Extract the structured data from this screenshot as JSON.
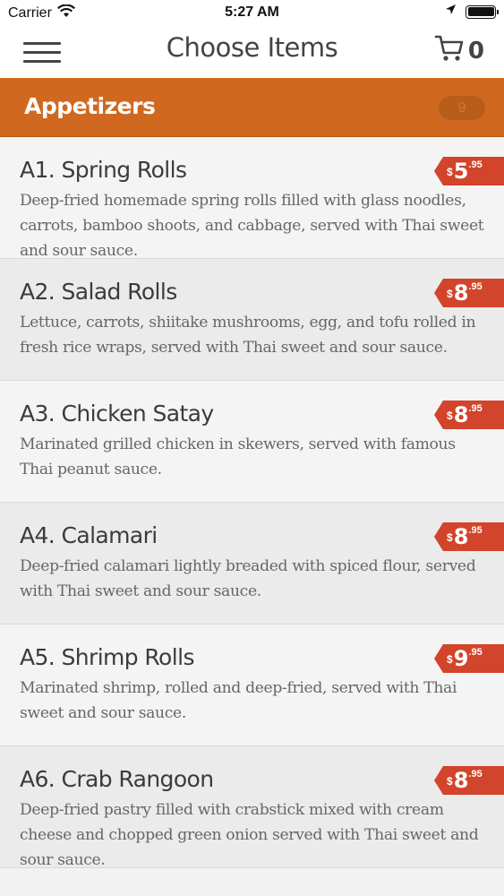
{
  "status_bar": {
    "carrier": "Carrier",
    "time": "5:27 AM"
  },
  "navbar": {
    "title": "Choose Items",
    "cart_count": "0"
  },
  "category": {
    "title": "Appetizers",
    "count": "9",
    "color": "#d0691f"
  },
  "price_tag_color": "#d2442b",
  "items": [
    {
      "name": "A1. Spring Rolls",
      "description": "Deep-fried homemade spring rolls filled with glass noodles, carrots, bamboo shoots, and cabbage, served with Thai sweet and sour sauce.",
      "price_currency": "$",
      "price_dollars": "5",
      "price_cents": ".95"
    },
    {
      "name": "A2. Salad Rolls",
      "description": "Lettuce, carrots, shiitake mushrooms, egg, and tofu rolled in fresh rice wraps, served with Thai sweet and sour sauce.",
      "price_currency": "$",
      "price_dollars": "8",
      "price_cents": ".95"
    },
    {
      "name": "A3. Chicken Satay",
      "description": "Marinated grilled chicken in skewers, served with famous Thai peanut sauce.",
      "price_currency": "$",
      "price_dollars": "8",
      "price_cents": ".95"
    },
    {
      "name": "A4. Calamari",
      "description": "Deep-fried calamari lightly breaded with spiced flour, served with Thai sweet and sour sauce.",
      "price_currency": "$",
      "price_dollars": "8",
      "price_cents": ".95"
    },
    {
      "name": "A5. Shrimp Rolls",
      "description": "Marinated shrimp, rolled and deep-fried, served with Thai sweet and sour sauce.",
      "price_currency": "$",
      "price_dollars": "9",
      "price_cents": ".95"
    },
    {
      "name": "A6. Crab Rangoon",
      "description": "Deep-fried pastry filled with crabstick mixed with cream cheese and chopped green onion served with Thai sweet and sour sauce.",
      "price_currency": "$",
      "price_dollars": "8",
      "price_cents": ".95"
    }
  ]
}
